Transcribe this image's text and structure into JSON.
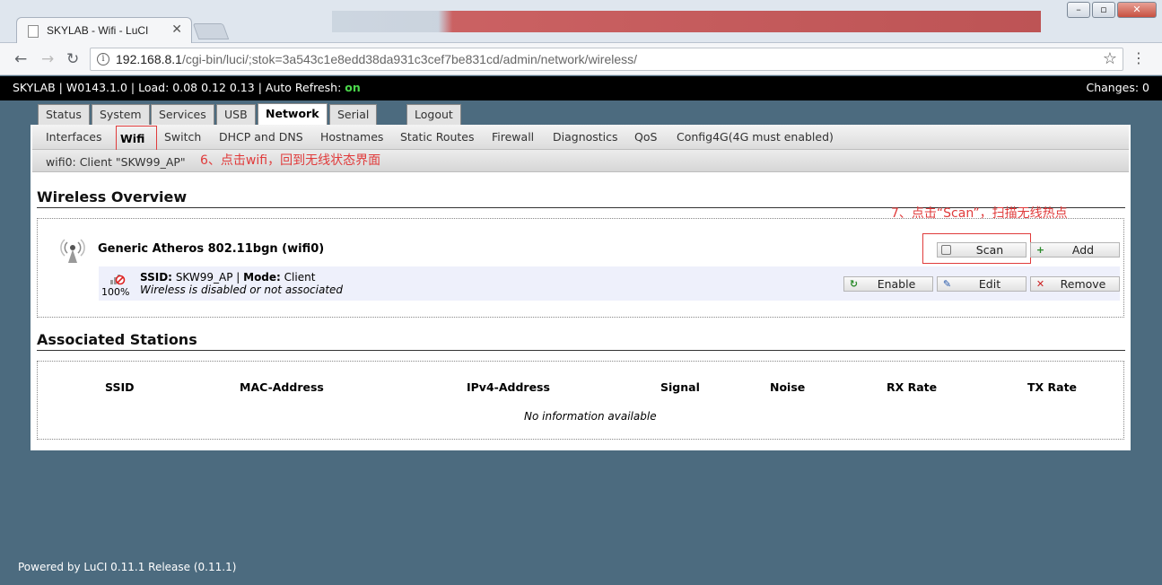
{
  "browser": {
    "tab_title": "SKYLAB - Wifi - LuCI",
    "url_host": "192.168.8.1",
    "url_path": "/cgi-bin/luci/;stok=3a543c1e8edd38da931c3cef7be831cd/admin/network/wireless/"
  },
  "header": {
    "host": "SKYLAB",
    "firmware": "W0143.1.0",
    "load_label": "Load:",
    "load": "0.08 0.12 0.13",
    "autorefresh_label": "Auto Refresh:",
    "autorefresh": "on",
    "changes": "Changes: 0"
  },
  "main_tabs": [
    "Status",
    "System",
    "Services",
    "USB",
    "Network",
    "Serial",
    "Logout"
  ],
  "sub_tabs": [
    "Interfaces",
    "Wifi",
    "Switch",
    "DHCP and DNS",
    "Hostnames",
    "Static Routes",
    "Firewall",
    "Diagnostics",
    "QoS",
    "Config4G(4G must enabled)"
  ],
  "sub_tab2": "wifi0: Client \"SKW99_AP\"",
  "annotations": {
    "note1": "6、点击wifi，回到无线状态界面",
    "note2": "7、点击“Scan”，扫描无线热点"
  },
  "wireless": {
    "title": "Wireless Overview",
    "device": "Generic Atheros 802.11bgn (wifi0)",
    "scan": "Scan",
    "add": "Add",
    "signal": "100%",
    "ssid_label": "SSID:",
    "ssid": "SKW99_AP",
    "mode_label": "Mode:",
    "mode": "Client",
    "status": "Wireless is disabled or not associated",
    "enable": "Enable",
    "edit": "Edit",
    "remove": "Remove"
  },
  "stations": {
    "title": "Associated Stations",
    "columns": [
      "SSID",
      "MAC-Address",
      "IPv4-Address",
      "Signal",
      "Noise",
      "RX Rate",
      "TX Rate"
    ],
    "empty": "No information available"
  },
  "footer": "Powered by LuCI 0.11.1 Release (0.11.1)",
  "colors": {
    "page_bg": "#4c6b7f",
    "annotation": "#e03b3b",
    "autorefresh_on": "#4bd74b"
  }
}
